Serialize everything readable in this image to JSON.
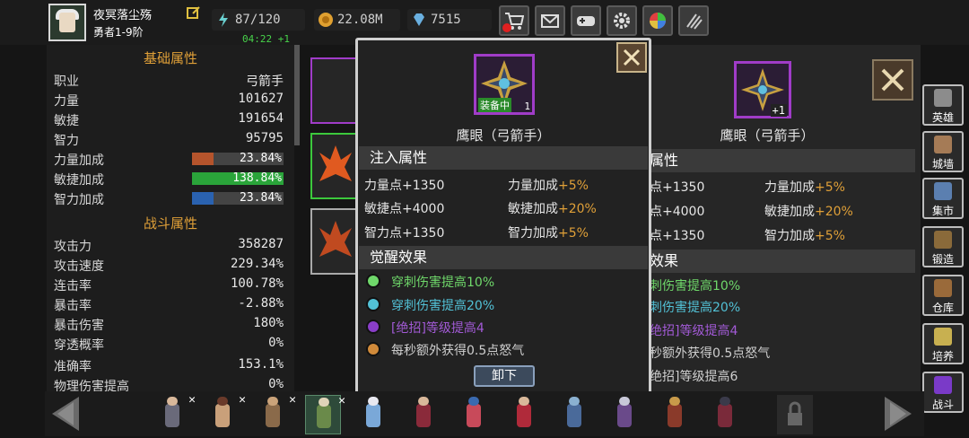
{
  "player": {
    "name": "夜冥落尘殇",
    "rank": "勇者1-9阶"
  },
  "resources": {
    "stamina": "87/120",
    "timer": "04:22 +1",
    "gold": "22.08M",
    "gems": "7515"
  },
  "left_panel": {
    "base_title": "基础属性",
    "base": [
      {
        "k": "职业",
        "v": "弓箭手"
      },
      {
        "k": "力量",
        "v": "101627"
      },
      {
        "k": "敏捷",
        "v": "191654"
      },
      {
        "k": "智力",
        "v": "95795"
      }
    ],
    "bonus": [
      {
        "k": "力量加成",
        "v": "23.84%",
        "pct": 23.84,
        "color": "#b5542c"
      },
      {
        "k": "敏捷加成",
        "v": "138.84%",
        "pct": 100,
        "color": "#2aa43a"
      },
      {
        "k": "智力加成",
        "v": "23.84%",
        "pct": 23.84,
        "color": "#2a62b0"
      }
    ],
    "combat_title": "战斗属性",
    "combat": [
      {
        "k": "攻击力",
        "v": "358287"
      },
      {
        "k": "攻击速度",
        "v": "229.34%"
      },
      {
        "k": "连击率",
        "v": "100.78%"
      },
      {
        "k": "暴击率",
        "v": "-2.88%"
      },
      {
        "k": "暴击伤害",
        "v": "180%"
      },
      {
        "k": "穿透概率",
        "v": "0%"
      },
      {
        "k": "准确率",
        "v": "153.1%"
      },
      {
        "k": "物理伤害提高",
        "v": "0%"
      }
    ]
  },
  "popup": {
    "equipped_badge": "装备中",
    "level": "1",
    "item_name": "鹰眼（弓箭手）",
    "infuse_title": "注入属性",
    "infuse": [
      {
        "a": "力量点",
        "av": "+1350",
        "b": "力量加成",
        "bv": "+5%"
      },
      {
        "a": "敏捷点",
        "av": "+4000",
        "b": "敏捷加成",
        "bv": "+20%"
      },
      {
        "a": "智力点",
        "av": "+1350",
        "b": "智力加成",
        "bv": "+5%"
      }
    ],
    "awaken_title": "觉醒效果",
    "awaken": [
      {
        "text": "穿刺伤害提高10%",
        "color": "#6fd86a",
        "dot": "#6fd86a"
      },
      {
        "text": "穿刺伤害提高20%",
        "color": "#52c1d6",
        "dot": "#52c1d6"
      },
      {
        "text": "[绝招]等级提高4",
        "color": "#a25ad6",
        "dot": "#8a3ec8"
      },
      {
        "text": "每秒额外获得0.5点怒气",
        "color": "#cfcfcf",
        "dot": "#d08a3a"
      }
    ],
    "unequip": "卸下"
  },
  "right_card": {
    "level": "+1",
    "item_name": "鹰眼（弓箭手）",
    "infuse_title": "属性",
    "infuse": [
      {
        "a": "点",
        "av": "+1350",
        "b": "力量加成",
        "bv": "+5%"
      },
      {
        "a": "点",
        "av": "+4000",
        "b": "敏捷加成",
        "bv": "+20%"
      },
      {
        "a": "点",
        "av": "+1350",
        "b": "智力加成",
        "bv": "+5%"
      }
    ],
    "awaken_title": "效果",
    "awaken": [
      {
        "text": "刺伤害提高10%",
        "color": "#6fd86a"
      },
      {
        "text": "刺伤害提高20%",
        "color": "#52c1d6"
      },
      {
        "text": "绝招]等级提高4",
        "color": "#a25ad6"
      },
      {
        "text": "秒额外获得0.5点怒气",
        "color": "#cfcfcf"
      },
      {
        "text": "绝招]等级提高6",
        "color": "#cfcfcf"
      }
    ]
  },
  "side_nav": [
    {
      "label": "英雄",
      "icon": "helmet-icon",
      "color": "#8c8c8c"
    },
    {
      "label": "城墙",
      "icon": "wall-icon",
      "color": "#a57b56"
    },
    {
      "label": "集市",
      "icon": "market-icon",
      "color": "#5b7fb0"
    },
    {
      "label": "锻造",
      "icon": "anvil-icon",
      "color": "#8a6a3a"
    },
    {
      "label": "仓库",
      "icon": "warehouse-icon",
      "color": "#9a6a3a"
    },
    {
      "label": "培养",
      "icon": "trophy-icon",
      "color": "#c8b050"
    },
    {
      "label": "战斗",
      "icon": "portal-icon",
      "color": "#7a3ac8"
    }
  ],
  "heroes": [
    {
      "body": "#6a6a7a",
      "head": "#d9b89a",
      "x": true
    },
    {
      "body": "#c9a07a",
      "head": "#6a3a2a",
      "x": true
    },
    {
      "body": "#8a6a4a",
      "head": "#caa37a",
      "x": true
    },
    {
      "body": "#6a8a4a",
      "head": "#e0d4b8",
      "x": true,
      "selected": true
    },
    {
      "body": "#7aa8d8",
      "head": "#e8e8f0",
      "x": false
    },
    {
      "body": "#8a2a3a",
      "head": "#d9b89a",
      "x": false
    },
    {
      "body": "#c84a5a",
      "head": "#3a6ab0",
      "x": false
    },
    {
      "body": "#b02a3a",
      "head": "#d9b89a",
      "x": false
    },
    {
      "body": "#4a6a9a",
      "head": "#8ab0d0",
      "x": false
    },
    {
      "body": "#6a4a8a",
      "head": "#c8c8d8",
      "x": false
    },
    {
      "body": "#8a3a2a",
      "head": "#c89a4a",
      "x": false
    },
    {
      "body": "#7a2a3a",
      "head": "#3a3a4a",
      "x": false
    }
  ]
}
